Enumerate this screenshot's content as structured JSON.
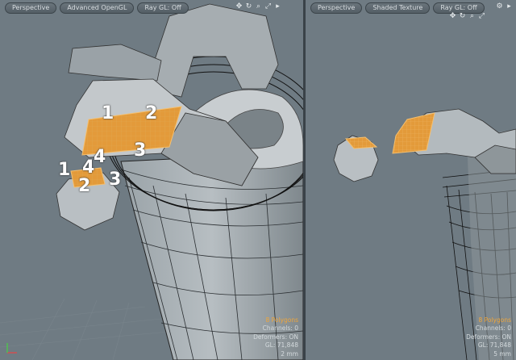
{
  "left_viewport": {
    "toolbar": {
      "view_mode": "Perspective",
      "render_mode": "Advanced OpenGL",
      "raygl": "Ray GL: Off"
    },
    "labels": {
      "upper": [
        "1",
        "2",
        "3",
        "4"
      ],
      "lower": [
        "1",
        "2",
        "3",
        "4"
      ]
    },
    "hud": {
      "polygons": "8 Polygons",
      "channels": "Channels: 0",
      "deformers": "Deformers: ON",
      "gl": "GL: 71,848",
      "scale": "2 mm"
    }
  },
  "right_viewport": {
    "toolbar": {
      "view_mode": "Perspective",
      "render_mode": "Shaded Texture",
      "raygl": "Ray GL: Off"
    },
    "hud": {
      "polygons": "8 Polygons",
      "channels": "Channels: 0",
      "deformers": "Deformers: ON",
      "gl": "GL: 71,848",
      "scale": "5 mm"
    }
  },
  "colors": {
    "selection": "#e39a3a",
    "hud_highlight": "#f0a63a",
    "background": "#6f7b83"
  },
  "icons": [
    "move-view-icon",
    "rotate-view-icon",
    "zoom-view-icon",
    "fit-view-icon",
    "menu-arrow-icon",
    "gear-icon"
  ]
}
